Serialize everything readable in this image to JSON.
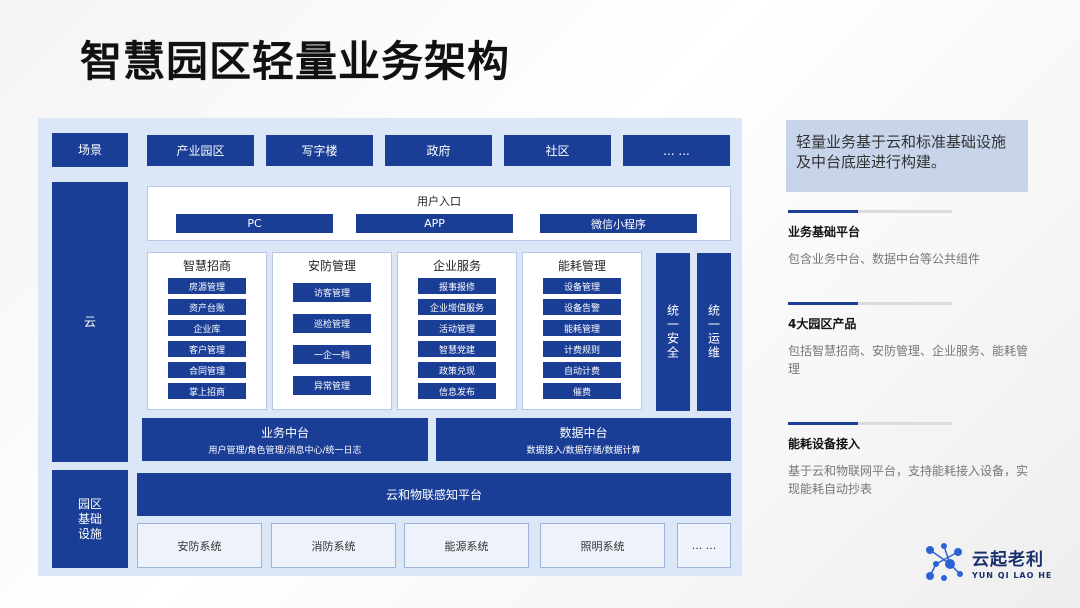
{
  "title": "智慧园区轻量业务架构",
  "rows": {
    "scene_label": "场景",
    "cloud_label": "云",
    "infra_label": "园区\n基础\n设施"
  },
  "scenes": [
    "产业园区",
    "写字楼",
    "政府",
    "社区",
    "... ..."
  ],
  "user_entry": {
    "title": "用户入口",
    "items": [
      "PC",
      "APP",
      "微信小程序"
    ]
  },
  "modules": [
    {
      "title": "智慧招商",
      "items": [
        "房源管理",
        "资产台账",
        "企业库",
        "客户管理",
        "合同管理",
        "掌上招商"
      ]
    },
    {
      "title": "安防管理",
      "items": [
        "访客管理",
        "巡检管理",
        "一企一档",
        "异常管理"
      ]
    },
    {
      "title": "企业服务",
      "items": [
        "报事报修",
        "企业增值服务",
        "活动管理",
        "智慧党建",
        "政策兑现",
        "信息发布"
      ]
    },
    {
      "title": "能耗管理",
      "items": [
        "设备管理",
        "设备告警",
        "能耗管理",
        "计费规则",
        "自动计费",
        "催费"
      ]
    }
  ],
  "vertical": [
    "统一安全",
    "统一运维"
  ],
  "middle": [
    {
      "title": "业务中台",
      "sub": "用户管理/角色管理/消息中心/统一日志"
    },
    {
      "title": "数据中台",
      "sub": "数据接入/数据存储/数据计算"
    }
  ],
  "iot_platform": "云和物联感知平台",
  "systems": [
    "安防系统",
    "消防系统",
    "能源系统",
    "照明系统",
    "... ..."
  ],
  "note": "轻量业务基于云和标准基础设施及中台底座进行构建。",
  "features": [
    {
      "title": "业务基础平台",
      "desc": "包含业务中台、数据中台等公共组件"
    },
    {
      "title": "4大园区产品",
      "desc": "包括智慧招商、安防管理、企业服务、能耗管理"
    },
    {
      "title": "能耗设备接入",
      "desc": "基于云和物联网平台，支持能耗接入设备，实现能耗自动抄表"
    }
  ],
  "logo": {
    "cn": "云起老利",
    "en": "YUN QI LAO HE",
    "icon": "network-dots-icon"
  },
  "colors": {
    "primary": "#1a3d96",
    "panel": "#dbe6f6",
    "note_bg": "#c7d4ea"
  }
}
